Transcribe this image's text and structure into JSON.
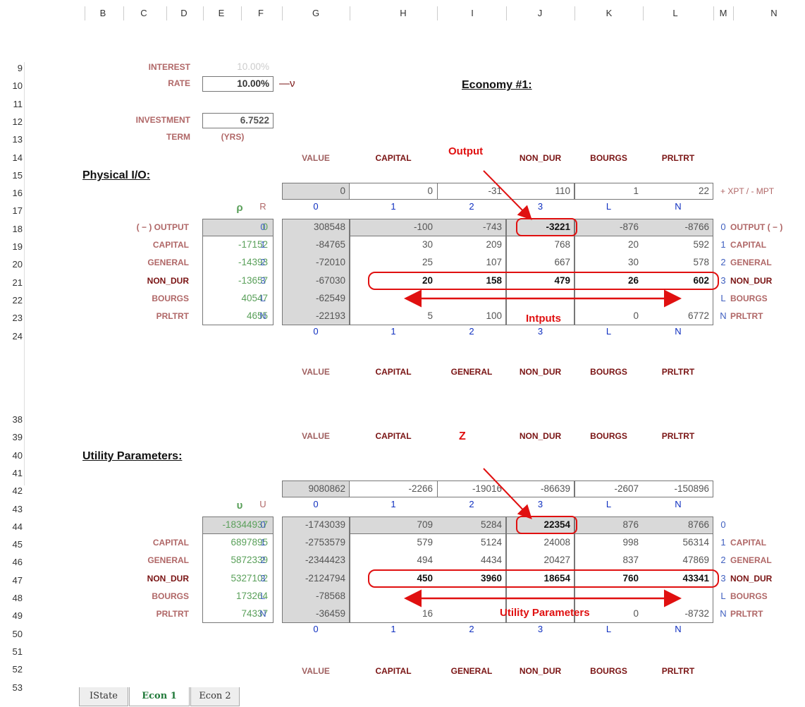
{
  "columns": [
    "B",
    "C",
    "D",
    "E",
    "F",
    "G",
    "H",
    "I",
    "J",
    "K",
    "L",
    "M",
    "N"
  ],
  "rows1": [
    "9",
    "10",
    "11",
    "12",
    "13",
    "14",
    "15",
    "16",
    "17",
    "18",
    "19",
    "20",
    "21",
    "22",
    "23",
    "24"
  ],
  "rows2": [
    "38",
    "39",
    "40",
    "41",
    "42",
    "43",
    "44",
    "45",
    "46",
    "47",
    "48",
    "49",
    "50",
    "51",
    "52",
    "53"
  ],
  "params": {
    "interest": "INTEREST",
    "rate": "RATE",
    "interest_val": "10.00%",
    "rate_val": "10.00%",
    "nu": "—ν",
    "investment": "INVESTMENT",
    "term": "TERM",
    "investment_val": "6.7522",
    "yrs": "(YRS)"
  },
  "economy_title": "Economy #1:",
  "physical_title": "Physical I/O:",
  "utility_title": "Utility Parameters:",
  "headers": [
    "VALUE",
    "CAPITAL",
    "GENERAL",
    "NON_DUR",
    "BOURGS",
    "PRLTRT"
  ],
  "annotations": {
    "output": "Output",
    "inputs": "Intputs",
    "z": "Z",
    "utility": "Utility Parameters"
  },
  "physical": {
    "rho": "ρ",
    "R": "R",
    "top_row": [
      "0",
      "0",
      "-31",
      "110",
      "1",
      "22"
    ],
    "xpt": "+ XPT / - MPT",
    "col_idx": [
      "0",
      "1",
      "2",
      "3",
      "L",
      "N"
    ],
    "rows": [
      {
        "label": "( − ) OUTPUT",
        "rho": "0",
        "r": "0",
        "vals": [
          "308548",
          "-100",
          "-743",
          "-3221",
          "-876",
          "-8766"
        ],
        "right_idx": "0",
        "right_label": "OUTPUT ( − )"
      },
      {
        "label": "CAPITAL",
        "rho": "-17152",
        "r": "1",
        "vals": [
          "-84765",
          "30",
          "209",
          "768",
          "20",
          "592"
        ],
        "right_idx": "1",
        "right_label": "CAPITAL"
      },
      {
        "label": "GENERAL",
        "rho": "-14393",
        "r": "2",
        "vals": [
          "-72010",
          "25",
          "107",
          "667",
          "30",
          "578"
        ],
        "right_idx": "2",
        "right_label": "GENERAL"
      },
      {
        "label": "NON_DUR",
        "rho": "-13657",
        "r": "3",
        "vals": [
          "-67030",
          "20",
          "158",
          "479",
          "26",
          "602"
        ],
        "right_idx": "3",
        "right_label": "NON_DUR"
      },
      {
        "label": "BOURGS",
        "rho": "40547",
        "r": "L",
        "vals": [
          "-62549",
          "",
          "",
          "",
          "",
          ""
        ],
        "right_idx": "L",
        "right_label": "BOURGS"
      },
      {
        "label": "PRLTRT",
        "rho": "4655",
        "r": "N",
        "vals": [
          "-22193",
          "5",
          "100",
          "",
          "0",
          "6772"
        ],
        "right_idx": "N",
        "right_label": "PRLTRT"
      }
    ]
  },
  "utility": {
    "upsilon": "υ",
    "U": "U",
    "top_row": [
      "9080862",
      "-2266",
      "-19016",
      "-86639",
      "-2607",
      "-150896"
    ],
    "col_idx": [
      "0",
      "1",
      "2",
      "3",
      "L",
      "N"
    ],
    "rows": [
      {
        "label": "",
        "ups": "-18344937",
        "r": "0",
        "vals": [
          "-1743039",
          "709",
          "5284",
          "22354",
          "876",
          "8766"
        ],
        "right_idx": "0",
        "right_label": ""
      },
      {
        "label": "CAPITAL",
        "ups": "6897895",
        "r": "1",
        "vals": [
          "-2753579",
          "579",
          "5124",
          "24008",
          "998",
          "56314"
        ],
        "right_idx": "1",
        "right_label": "CAPITAL"
      },
      {
        "label": "GENERAL",
        "ups": "5872339",
        "r": "2",
        "vals": [
          "-2344423",
          "494",
          "4434",
          "20427",
          "837",
          "47869"
        ],
        "right_idx": "2",
        "right_label": "GENERAL"
      },
      {
        "label": "NON_DUR",
        "ups": "5327102",
        "r": "3",
        "vals": [
          "-2124794",
          "450",
          "3960",
          "18654",
          "760",
          "43341"
        ],
        "right_idx": "3",
        "right_label": "NON_DUR"
      },
      {
        "label": "BOURGS",
        "ups": "173264",
        "r": "L",
        "vals": [
          "-78568",
          "",
          "",
          "",
          "",
          ""
        ],
        "right_idx": "L",
        "right_label": "BOURGS"
      },
      {
        "label": "PRLTRT",
        "ups": "74337",
        "r": "N",
        "vals": [
          "-36459",
          "16",
          "",
          "",
          "0",
          "-8732"
        ],
        "right_idx": "N",
        "right_label": "PRLTRT"
      }
    ]
  },
  "tabs": [
    "IState",
    "Econ 1",
    "Econ 2"
  ]
}
